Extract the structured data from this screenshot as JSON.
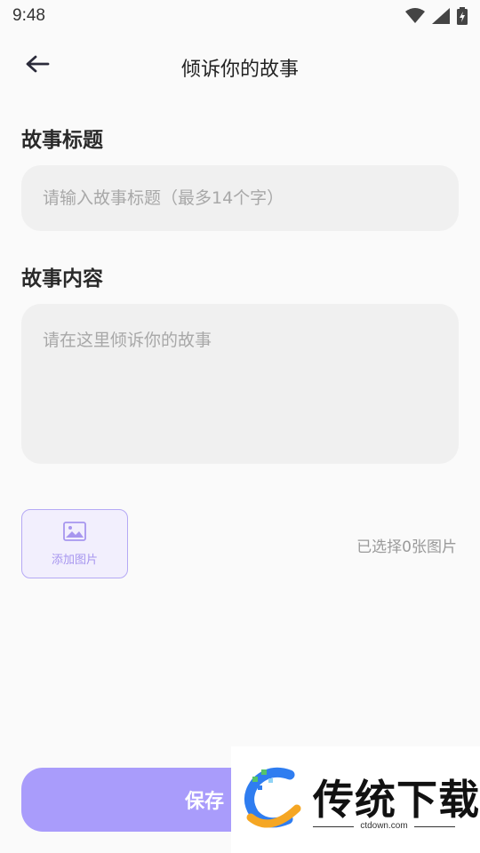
{
  "status_bar": {
    "time": "9:48",
    "icons": [
      "wifi-icon",
      "signal-icon",
      "battery-charging-icon"
    ]
  },
  "app_bar": {
    "back_icon": "arrow-left-icon",
    "title": "倾诉你的故事"
  },
  "form": {
    "title_section": {
      "label": "故事标题",
      "value": "",
      "placeholder": "请输入故事标题（最多14个字）"
    },
    "content_section": {
      "label": "故事内容",
      "value": "",
      "placeholder": "请在这里倾诉你的故事"
    },
    "images": {
      "add_label": "添加图片",
      "icon": "image-icon",
      "selected_text": "已选择0张图片"
    },
    "save_label": "保存"
  },
  "watermark": {
    "text": "传统下载",
    "subtext": "ctdown.com"
  },
  "colors": {
    "accent": "#a99cfb",
    "accent_border": "#b5a9f5",
    "field_bg": "#f0f0f0",
    "page_bg": "#fafafa"
  }
}
